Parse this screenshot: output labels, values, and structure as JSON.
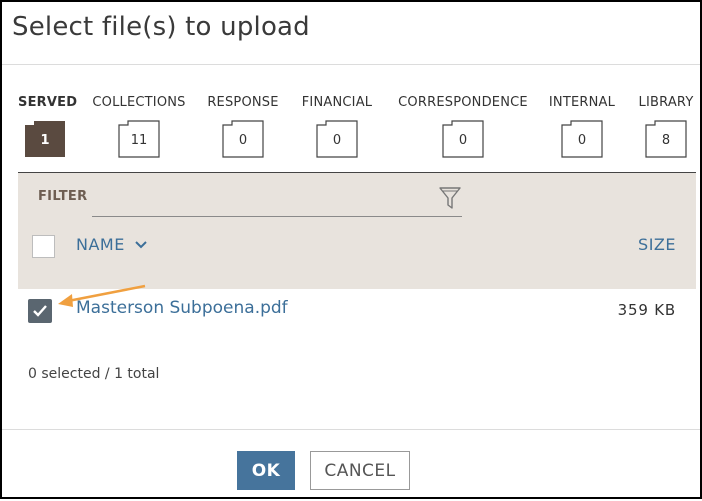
{
  "dialog": {
    "title": "Select file(s) to upload"
  },
  "tabs": [
    {
      "label": "SERVED",
      "count": "1",
      "active": true
    },
    {
      "label": "COLLECTIONS",
      "count": "11",
      "active": false
    },
    {
      "label": "RESPONSE",
      "count": "0",
      "active": false
    },
    {
      "label": "FINANCIAL",
      "count": "0",
      "active": false
    },
    {
      "label": "CORRESPONDENCE",
      "count": "0",
      "active": false
    },
    {
      "label": "INTERNAL",
      "count": "0",
      "active": false
    },
    {
      "label": "LIBRARY",
      "count": "8",
      "active": false
    }
  ],
  "filter": {
    "label": "FILTER",
    "value": "",
    "icon": "funnel-icon"
  },
  "table": {
    "name_header": "NAME",
    "size_header": "SIZE",
    "rows": [
      {
        "name": "Masterson Subpoena.pdf",
        "size": "359 KB",
        "checked": true
      }
    ]
  },
  "status": {
    "text": "0 selected / 1 total"
  },
  "buttons": {
    "ok": "OK",
    "cancel": "CANCEL"
  },
  "colors": {
    "accent": "#46749c",
    "link": "#3c6f99",
    "active_folder": "#5a4a40",
    "panel": "#e8e3dd",
    "annotation_arrow": "#f0a040"
  }
}
